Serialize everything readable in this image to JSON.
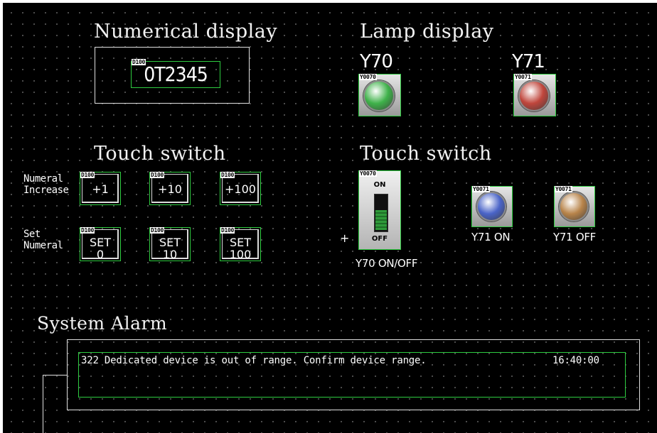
{
  "numerical_display": {
    "title": "Numerical display",
    "device": "D100",
    "value": "0T2345"
  },
  "lamp_display": {
    "title": "Lamp display",
    "lamps": [
      {
        "label": "Y70",
        "device": "Y0070",
        "color": "#3fb24a"
      },
      {
        "label": "Y71",
        "device": "Y0071",
        "color": "#c0463c"
      }
    ]
  },
  "touch_switch_left": {
    "title": "Touch switch",
    "rows": [
      {
        "label_line1": "Numeral",
        "label_line2": "Increase",
        "buttons": [
          {
            "device": "D100",
            "line1": "+1",
            "line2": ""
          },
          {
            "device": "D100",
            "line1": "+10",
            "line2": ""
          },
          {
            "device": "D100",
            "line1": "+100",
            "line2": ""
          }
        ]
      },
      {
        "label_line1": "Set",
        "label_line2": "Numeral",
        "buttons": [
          {
            "device": "D100",
            "line1": "SET",
            "line2": "0"
          },
          {
            "device": "D100",
            "line1": "SET",
            "line2": "10"
          },
          {
            "device": "D100",
            "line1": "SET",
            "line2": "100"
          }
        ]
      }
    ]
  },
  "touch_switch_right": {
    "title": "Touch switch",
    "toggle": {
      "device": "Y0070",
      "on_label": "ON",
      "off_label": "OFF",
      "caption": "Y70 ON/OFF",
      "marker": "+"
    },
    "buttons": [
      {
        "device": "Y0071",
        "caption": "Y71 ON",
        "color": "#4a64c8"
      },
      {
        "device": "Y0071",
        "caption": "Y71 OFF",
        "color": "#b8844a"
      }
    ]
  },
  "system_alarm": {
    "title": "System Alarm",
    "message": "322 Dedicated device is out of range. Confirm device range.",
    "time": "16:40:00"
  }
}
